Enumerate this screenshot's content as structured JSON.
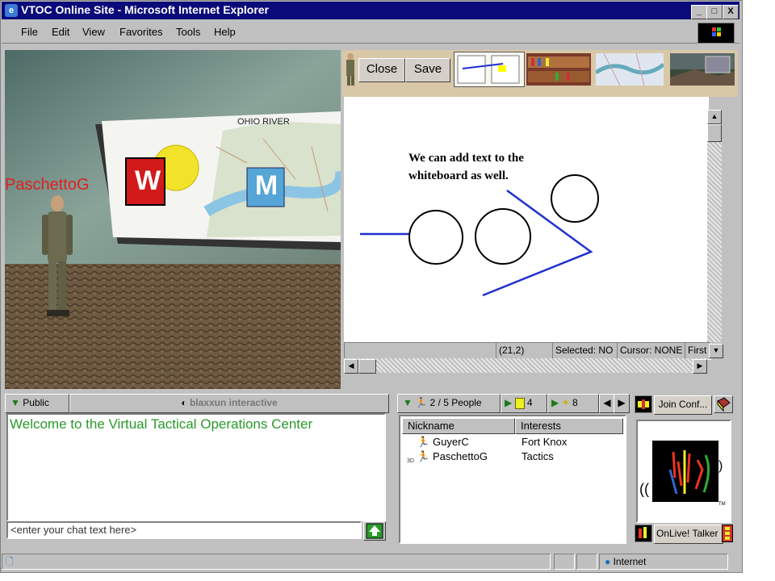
{
  "window": {
    "title": "VTOC Online Site - Microsoft Internet Explorer",
    "controls": [
      "_",
      "□",
      "X"
    ]
  },
  "menu": [
    "File",
    "Edit",
    "View",
    "Favorites",
    "Tools",
    "Help"
  ],
  "scene": {
    "avatar_name": "PaschettoG",
    "sign_letters": [
      "W",
      "M"
    ]
  },
  "whiteboard": {
    "close_label": "Close",
    "save_label": "Save",
    "text_line1": "We can add text to the",
    "text_line2": "whiteboard as well.",
    "status": {
      "coords": "(21,2)",
      "selected": "Selected: NO",
      "cursor": "Cursor: NONE",
      "first": "First"
    }
  },
  "chat": {
    "tab_label": "Public",
    "brand": "blaxxun interactive",
    "welcome": "Welcome to the Virtual Tactical Operations Center",
    "input_placeholder": "<enter your chat text here>"
  },
  "people": {
    "count_label": "2 / 5 People",
    "tab2_count": "4",
    "tab3_count": "8",
    "columns": [
      "Nickname",
      "Interests"
    ],
    "rows": [
      {
        "badge": "",
        "nickname": "GuyerC",
        "interests": "Fort Knox"
      },
      {
        "badge": "3D",
        "nickname": "PaschettoG",
        "interests": "Tactics"
      }
    ]
  },
  "conference": {
    "join_label": "Join Conf...",
    "talk_label": "OnLive! Talker"
  },
  "statusbar": {
    "zone": "Internet"
  },
  "colors": {
    "title_bar": "#0a0a7a",
    "chat_text": "#2a9a2a",
    "avatar_label": "#e02020",
    "whiteboard_line": "#1f2fd0"
  }
}
